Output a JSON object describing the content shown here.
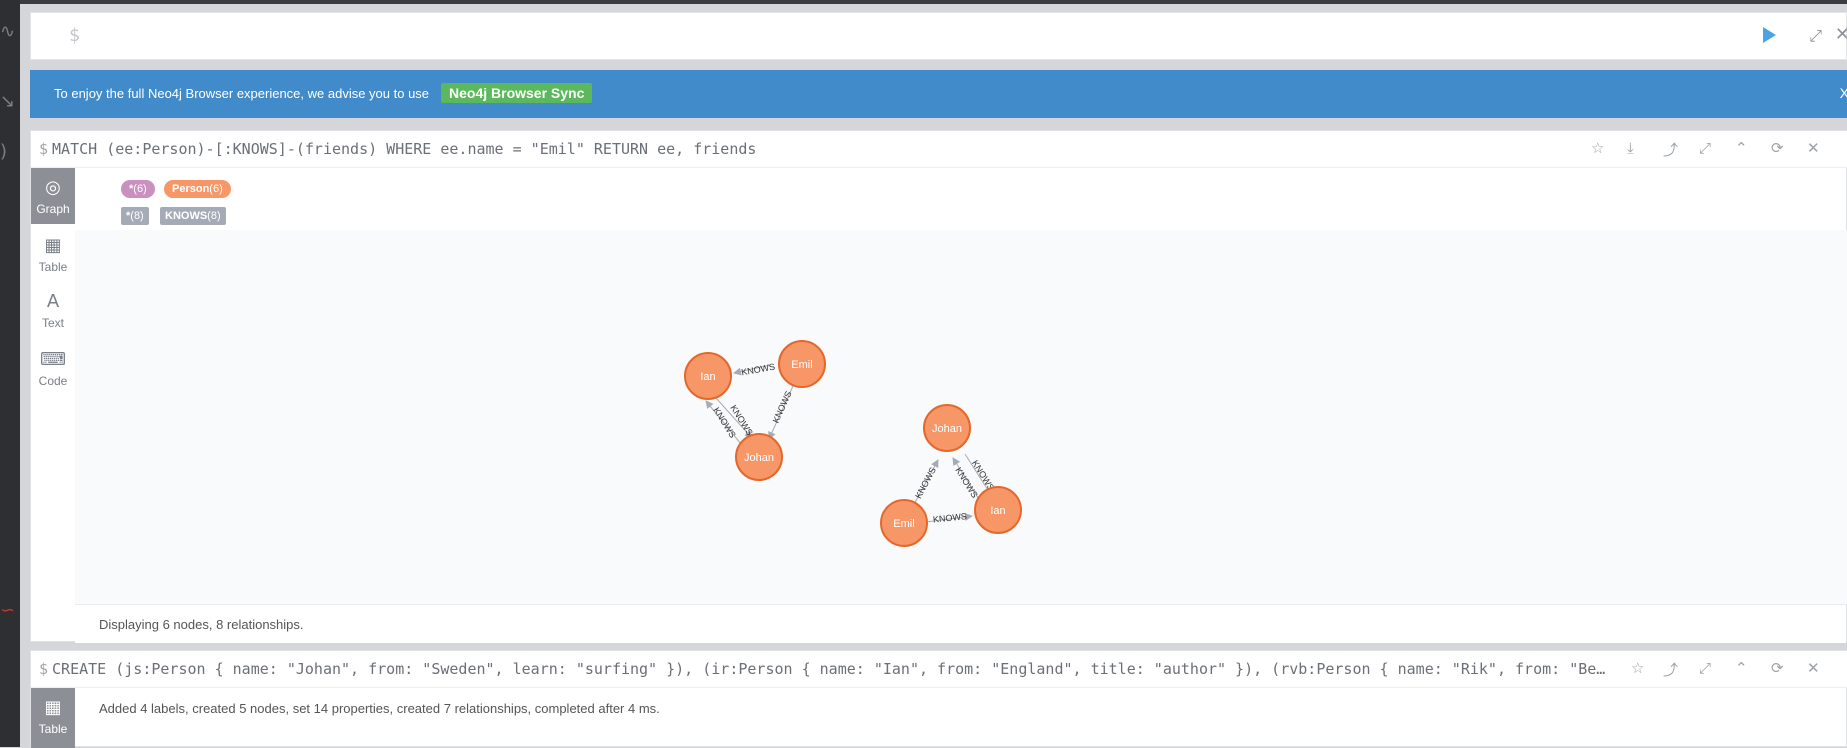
{
  "sidebar": {
    "icons": [
      "database-icon",
      "star-icon",
      "info-icon",
      "settings-icon"
    ]
  },
  "editor": {
    "prompt": "$",
    "icons": {
      "run": "play-icon",
      "expand": "⤢",
      "close": "✕"
    }
  },
  "banner": {
    "message": "To enjoy the full Neo4j Browser experience, we advise you to use",
    "button": "Neo4j Browser Sync",
    "close": "X",
    "color": "#428bca",
    "button_color": "#5cb85c"
  },
  "frame1": {
    "prompt": "$",
    "query": "MATCH (ee:Person)-[:KNOWS]-(friends) WHERE ee.name = \"Emil\" RETURN ee, friends",
    "tabs": [
      {
        "label": "Graph",
        "icon": "◎"
      },
      {
        "label": "Table",
        "icon": "▦"
      },
      {
        "label": "Text",
        "icon": "A"
      },
      {
        "label": "Code",
        "icon": "⌨"
      }
    ],
    "legend": {
      "node_labels": [
        {
          "name": "*",
          "count": "(6)",
          "color": "#c990c0"
        },
        {
          "name": "Person",
          "count": "(6)",
          "color": "#f79767"
        }
      ],
      "rel_types": [
        {
          "name": "*",
          "count": "(8)",
          "color": "#a5abb6"
        },
        {
          "name": "KNOWS",
          "count": "(8)",
          "color": "#a5abb6"
        }
      ]
    },
    "graph": {
      "nodes": [
        "Ian",
        "Emil",
        "Johan",
        "Johan",
        "Emil",
        "Ian"
      ],
      "rel_label": "KNOWS"
    },
    "status": "Displaying 6 nodes, 8 relationships."
  },
  "frame2": {
    "prompt": "$",
    "query": "CREATE (js:Person { name: \"Johan\", from: \"Sweden\", learn: \"surfing\" }), (ir:Person { name: \"Ian\", from: \"England\", title: \"author\" }), (rvb:Person { name: \"Rik\", from: \"Belgium\", pet: \"Orval\" }), (ally:Person { name: \"Allison\", from: \"California\", hobby: \"surfing\" })",
    "tab": {
      "label": "Table",
      "icon": "▦"
    },
    "result": "Added 4 labels, created 5 nodes, set 14 properties, created 7 relationships, completed after 4 ms."
  }
}
